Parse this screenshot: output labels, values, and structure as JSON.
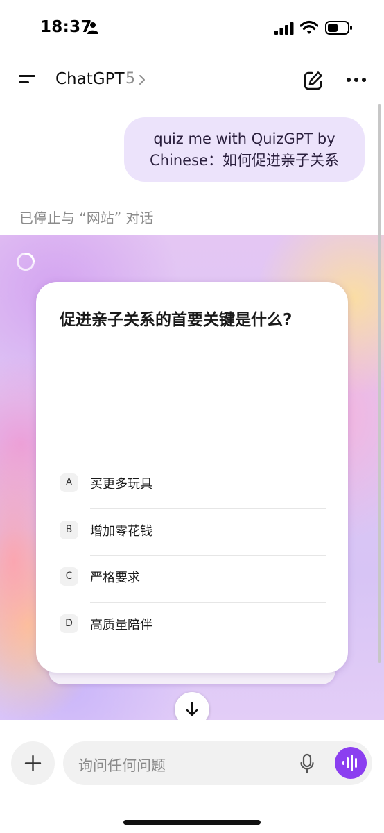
{
  "status_bar": {
    "time": "18:37"
  },
  "header": {
    "title": "ChatGPT",
    "version": "5"
  },
  "conversation": {
    "user_message_line1": "quiz me with QuizGPT by",
    "user_message_line2": "Chinese：如何促进亲子关系",
    "stopped_notice": "已停止与 “网站” 对话"
  },
  "quiz": {
    "question": "促进亲子关系的首要关键是什么?",
    "options": [
      {
        "letter": "A",
        "text": "买更多玩具"
      },
      {
        "letter": "B",
        "text": "增加零花钱"
      },
      {
        "letter": "C",
        "text": "严格要求"
      },
      {
        "letter": "D",
        "text": "高质量陪伴"
      }
    ]
  },
  "composer": {
    "placeholder": "询问任何问题"
  },
  "colors": {
    "user_bubble": "#ece3fb",
    "voice_button": "#8b3ff0"
  }
}
